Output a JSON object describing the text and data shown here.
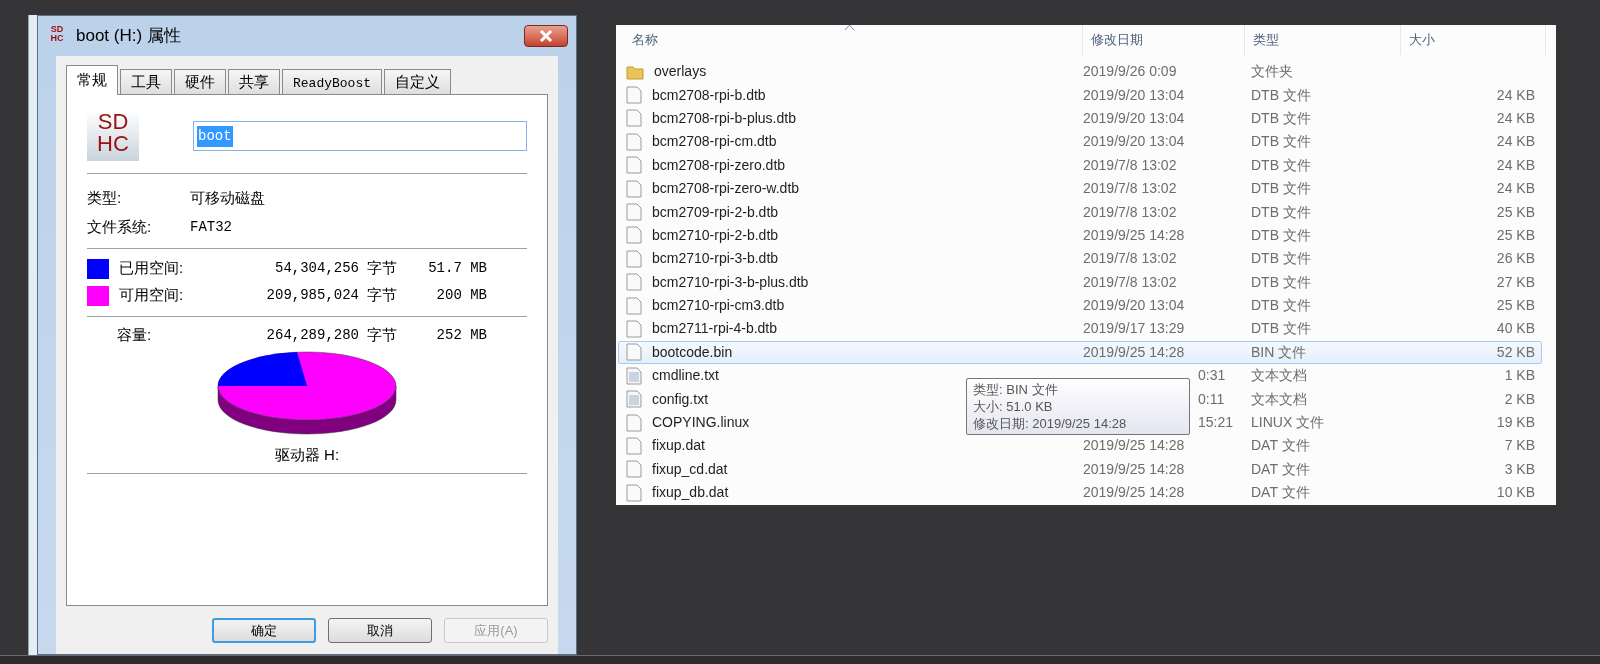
{
  "dialog": {
    "title": "boot (H:) 属性",
    "tabs": [
      {
        "label": "常规",
        "selected": true
      },
      {
        "label": "工具",
        "selected": false
      },
      {
        "label": "硬件",
        "selected": false
      },
      {
        "label": "共享",
        "selected": false
      },
      {
        "label": "ReadyBoost",
        "selected": false
      },
      {
        "label": "自定义",
        "selected": false
      }
    ],
    "name_field": {
      "value": "boot"
    },
    "title_icon": {
      "top": "SD",
      "bottom": "HC"
    },
    "drive_icon": {
      "top": "SD",
      "bottom": "HC"
    },
    "properties": [
      {
        "label": "类型:",
        "value": "可移动磁盘"
      },
      {
        "label": "文件系统:",
        "value": "FAT32"
      }
    ],
    "space": [
      {
        "label": "已用空间:",
        "bytes": "54,304,256",
        "unit": "字节",
        "size": "51.7 MB",
        "color": "#0000ff"
      },
      {
        "label": "可用空间:",
        "bytes": "209,985,024",
        "unit": "字节",
        "size": "200 MB",
        "color": "#ff00ff"
      }
    ],
    "capacity": {
      "label": "容量:",
      "bytes": "264,289,280",
      "unit": "字节",
      "size": "252 MB"
    },
    "drive_label": "驱动器 H:",
    "buttons": [
      {
        "label": "确定",
        "disabled": false,
        "default": true
      },
      {
        "label": "取消",
        "disabled": false,
        "default": false
      },
      {
        "label": "应用(A)",
        "disabled": true,
        "default": false
      }
    ]
  },
  "file_list": {
    "columns": [
      "名称",
      "修改日期",
      "类型",
      "大小"
    ],
    "rows": [
      {
        "kind": "folder",
        "name": "overlays",
        "date": "2019/9/26 0:09",
        "type": "文件夹",
        "selected": false
      },
      {
        "kind": "file",
        "name": "bcm2708-rpi-b.dtb",
        "date": "2019/9/20 13:04",
        "type": "DTB 文件",
        "size": "24 KB",
        "selected": false
      },
      {
        "kind": "file",
        "name": "bcm2708-rpi-b-plus.dtb",
        "date": "2019/9/20 13:04",
        "type": "DTB 文件",
        "size": "24 KB",
        "selected": false
      },
      {
        "kind": "file",
        "name": "bcm2708-rpi-cm.dtb",
        "date": "2019/9/20 13:04",
        "type": "DTB 文件",
        "size": "24 KB",
        "selected": false
      },
      {
        "kind": "file",
        "name": "bcm2708-rpi-zero.dtb",
        "date": "2019/7/8 13:02",
        "type": "DTB 文件",
        "size": "24 KB",
        "selected": false
      },
      {
        "kind": "file",
        "name": "bcm2708-rpi-zero-w.dtb",
        "date": "2019/7/8 13:02",
        "type": "DTB 文件",
        "size": "24 KB",
        "selected": false
      },
      {
        "kind": "file",
        "name": "bcm2709-rpi-2-b.dtb",
        "date": "2019/7/8 13:02",
        "type": "DTB 文件",
        "size": "25 KB",
        "selected": false
      },
      {
        "kind": "file",
        "name": "bcm2710-rpi-2-b.dtb",
        "date": "2019/9/25 14:28",
        "type": "DTB 文件",
        "size": "25 KB",
        "selected": false
      },
      {
        "kind": "file",
        "name": "bcm2710-rpi-3-b.dtb",
        "date": "2019/7/8 13:02",
        "type": "DTB 文件",
        "size": "26 KB",
        "selected": false
      },
      {
        "kind": "file",
        "name": "bcm2710-rpi-3-b-plus.dtb",
        "date": "2019/7/8 13:02",
        "type": "DTB 文件",
        "size": "27 KB",
        "selected": false
      },
      {
        "kind": "file",
        "name": "bcm2710-rpi-cm3.dtb",
        "date": "2019/9/20 13:04",
        "type": "DTB 文件",
        "size": "25 KB",
        "selected": false
      },
      {
        "kind": "file",
        "name": "bcm2711-rpi-4-b.dtb",
        "date": "2019/9/17 13:29",
        "type": "DTB 文件",
        "size": "40 KB",
        "selected": false
      },
      {
        "kind": "file",
        "name": "bootcode.bin",
        "date": "2019/9/25 14:28",
        "type": "BIN 文件",
        "size": "52 KB",
        "selected": true
      },
      {
        "kind": "text",
        "name": "cmdline.txt",
        "date": "0:31",
        "covered": true,
        "type": "文本文档",
        "size": "1 KB",
        "selected": false
      },
      {
        "kind": "text",
        "name": "config.txt",
        "date": "0:11",
        "covered": true,
        "type": "文本文档",
        "size": "2 KB",
        "selected": false
      },
      {
        "kind": "file",
        "name": "COPYING.linux",
        "date": "15:21",
        "covered": true,
        "type": "LINUX 文件",
        "size": "19 KB",
        "selected": false
      },
      {
        "kind": "file",
        "name": "fixup.dat",
        "date": "2019/9/25 14:28",
        "type": "DAT 文件",
        "size": "7 KB",
        "selected": false
      },
      {
        "kind": "file",
        "name": "fixup_cd.dat",
        "date": "2019/9/25 14:28",
        "type": "DAT 文件",
        "size": "3 KB",
        "selected": false
      },
      {
        "kind": "file",
        "name": "fixup_db.dat",
        "date": "2019/9/25 14:28",
        "type": "DAT 文件",
        "size": "10 KB",
        "selected": false
      }
    ],
    "tooltip": [
      "类型: BIN 文件",
      "大小: 51.0 KB",
      "修改日期: 2019/9/25 14:28"
    ]
  }
}
